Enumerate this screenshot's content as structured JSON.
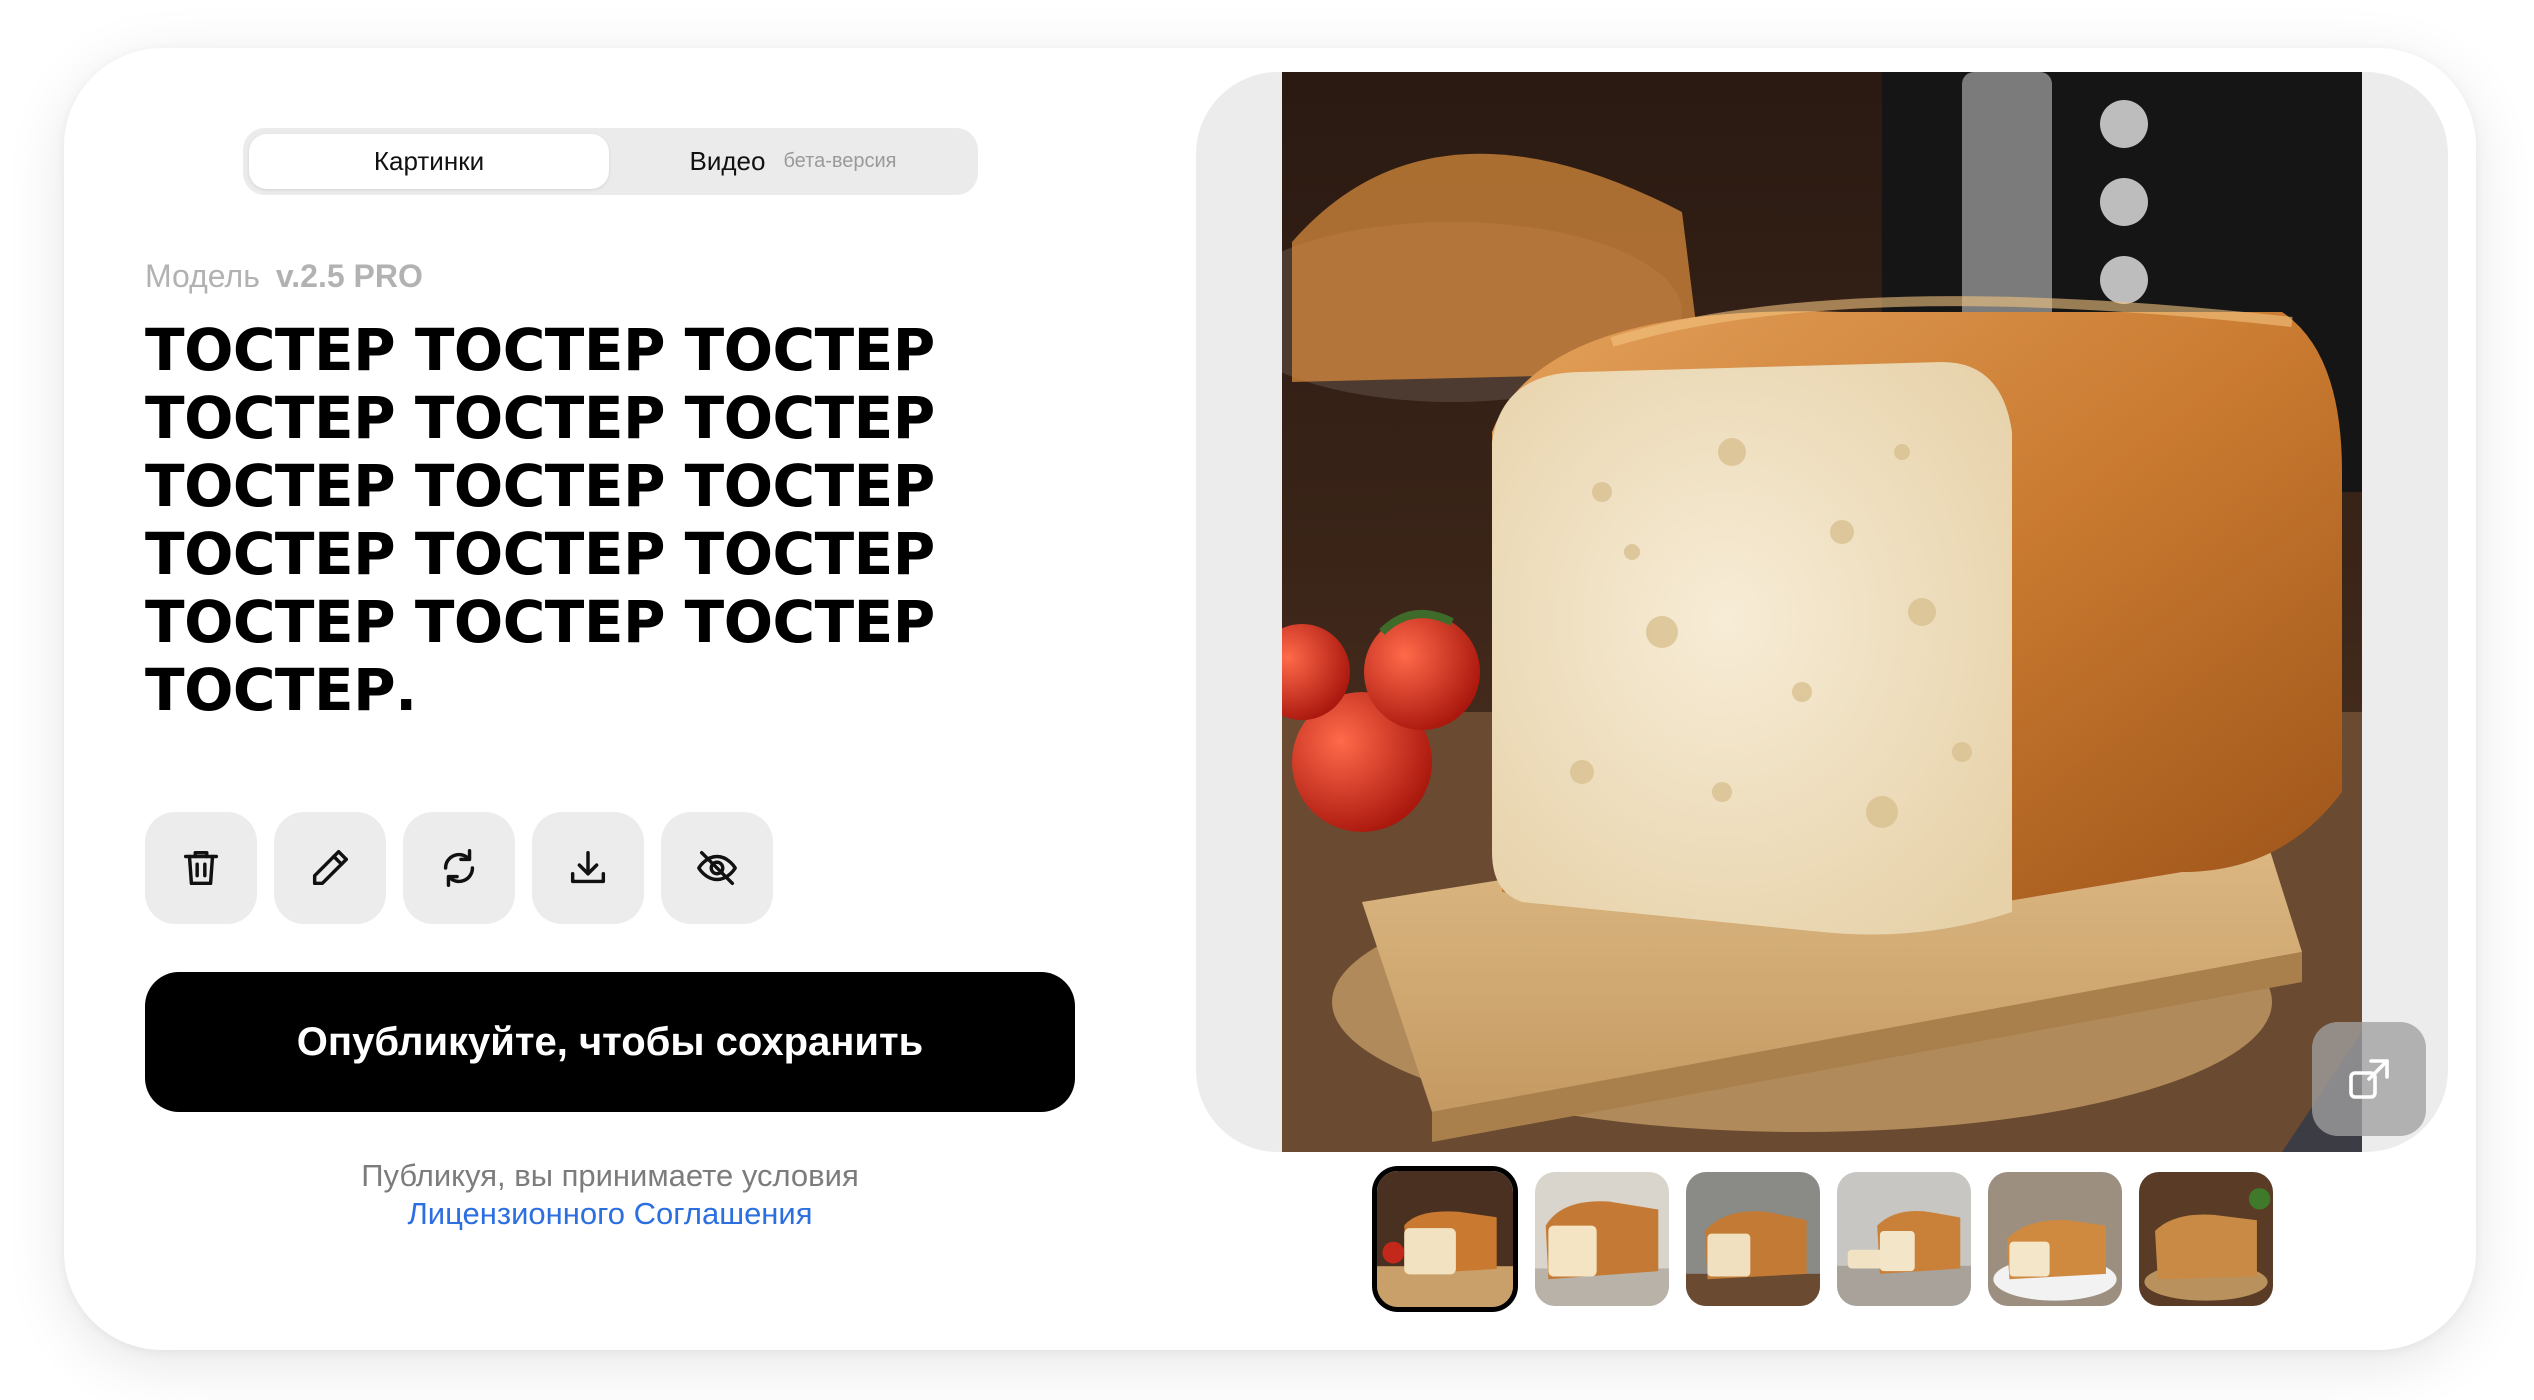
{
  "tabs": {
    "images_label": "Картинки",
    "video_label": "Видео",
    "video_badge": "бета-версия",
    "active": "images"
  },
  "model": {
    "label": "Модель",
    "version": "v.2.5 PRO"
  },
  "prompt": {
    "text": "ТОСТЕР ТОСТЕР ТОСТЕР ТОСТЕР ТОСТЕР ТОСТЕР ТОСТЕР ТОСТЕР ТОСТЕР ТОСТЕР ТОСТЕР ТОСТЕР ТОСТЕР ТОСТЕР ТОСТЕР ТОСТЕР."
  },
  "toolbar": {
    "icons": [
      "trash-icon",
      "pencil-icon",
      "refresh-icon",
      "download-icon",
      "eye-off-icon"
    ]
  },
  "publish": {
    "button_label": "Опубликуйте, чтобы сохранить"
  },
  "terms": {
    "text": "Публикуя, вы принимаете условия",
    "link_text": "Лицензионного Соглашения"
  },
  "preview": {
    "thumbnail_count": 6,
    "selected_index": 0
  },
  "colors": {
    "primary_button": "#000000",
    "link": "#2c6fe0",
    "panel": "#ececec"
  }
}
